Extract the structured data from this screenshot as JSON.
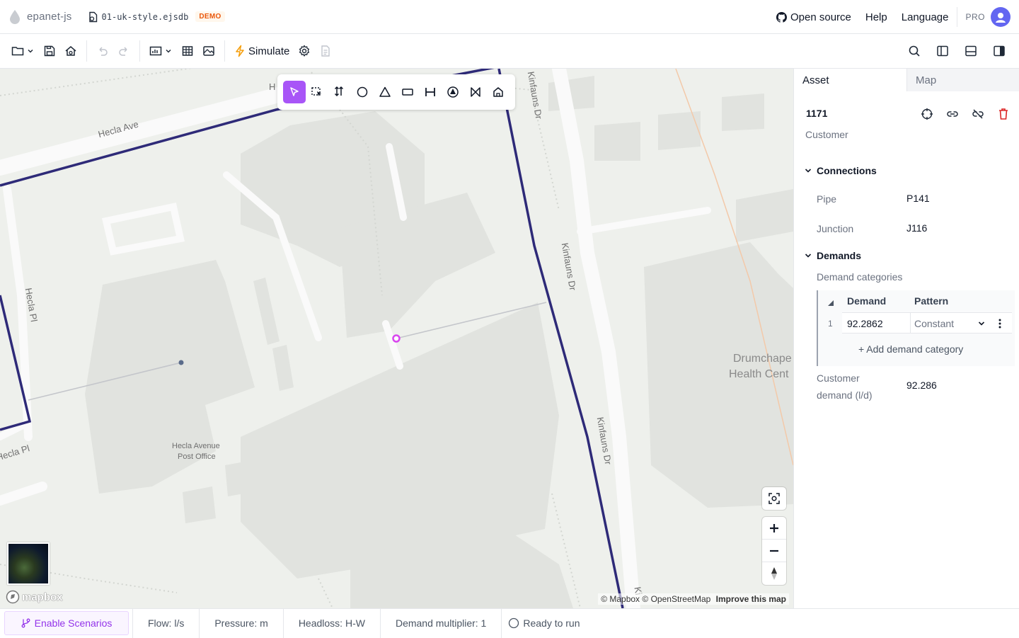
{
  "app": {
    "name": "epanet-js",
    "file_name": "01-uk-style.ejsdb",
    "badge": "DEMO",
    "links": [
      "Open source",
      "Help",
      "Language"
    ],
    "plan": "PRO"
  },
  "toolbar": {
    "simulate_label": "Simulate"
  },
  "map": {
    "street_labels": {
      "hecla_ave": "Hecla Ave",
      "hecla_ave_cut": "H",
      "hecla_pl_vertical": "Hecla Pl",
      "hecla_pl_bottom": "Hecla Pl",
      "kinfauns_top": "Kinfauns Dr",
      "kinfauns_mid": "Kinfauns Dr",
      "kinfauns_low": "Kinfauns Dr",
      "kinfauns_cut": "Ki"
    },
    "poi_labels": {
      "post_office_line1": "Hecla Avenue",
      "post_office_line2": "Post Office",
      "health_line1": "Drumchape",
      "health_line2": "Health Cent"
    },
    "attribution": {
      "mapbox": "© Mapbox",
      "osm": "© OpenStreetMap",
      "improve": "Improve this map"
    },
    "logo_text": "mapbox"
  },
  "panel": {
    "tabs": [
      "Asset",
      "Map"
    ],
    "asset_id": "1171",
    "asset_type": "Customer",
    "connections": {
      "title": "Connections",
      "rows": [
        {
          "key": "Pipe",
          "value": "P141"
        },
        {
          "key": "Junction",
          "value": "J116"
        }
      ]
    },
    "demands": {
      "title": "Demands",
      "categories_label": "Demand categories",
      "header_demand": "Demand",
      "header_pattern": "Pattern",
      "row_index": "1",
      "row_demand": "92.2862",
      "row_pattern": "Constant",
      "add_label": "+ Add demand category"
    },
    "customer_demand": {
      "key": "Customer demand (l/d)",
      "value": "92.286"
    }
  },
  "footer": {
    "scenarios_label": "Enable Scenarios",
    "flow": "Flow: l/s",
    "pressure": "Pressure: m",
    "headloss": "Headloss: H-W",
    "multiplier": "Demand multiplier: 1",
    "status": "Ready to run"
  },
  "colors": {
    "accent": "#a855f7",
    "pipe": "#2e2a78",
    "demo_badge": "#ea580c",
    "delete": "#dc2626"
  }
}
